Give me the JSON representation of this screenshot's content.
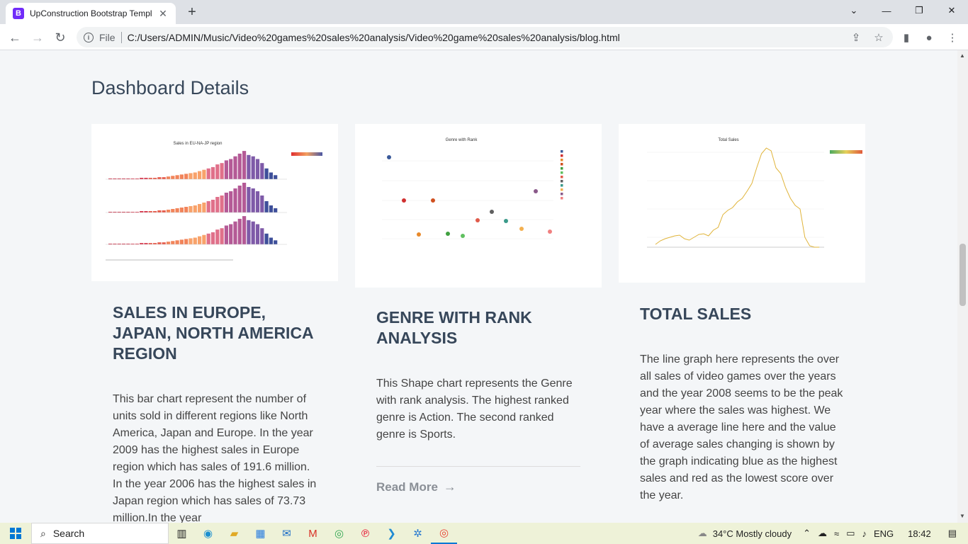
{
  "browser": {
    "tab_title": "UpConstruction Bootstrap Templ",
    "favicon_letter": "B",
    "file_label": "File",
    "url": "C:/Users/ADMIN/Music/Video%20games%20sales%20analysis/Video%20game%20sales%20analysis/blog.html"
  },
  "page": {
    "heading": "Dashboard Details"
  },
  "cards": [
    {
      "title": "SALES IN EUROPE, JAPAN, NORTH AMERICA REGION",
      "text": "This bar chart represent the number of units sold in different regions like North America, Japan and Europe. In the year 2009 has the highest sales in Europe region which has sales of 191.6 million. In the year 2006 has the highest sales in Japan region which has sales of 73.73 million.In the year",
      "chart_title": "Sales in EU-NA-JP region"
    },
    {
      "title": "GENRE WITH RANK ANALYSIS",
      "text": "This Shape chart represents the Genre with rank analysis. The highest ranked genre is Action. The second ranked genre is Sports.",
      "read_more": "Read More",
      "chart_title": "Genre with Rank"
    },
    {
      "title": "TOTAL SALES",
      "text": "The line graph here represents the over all sales of video games over the years and the year 2008 seems to be the peak year where the sales was highest. We have a average line here and the value of average sales changing is shown by the graph indicating blue as the highest sales and red as the lowest score over the year.",
      "chart_title": "Total Sales"
    }
  ],
  "taskbar": {
    "search": "Search",
    "weather": "34°C  Mostly cloudy",
    "lang": "ENG",
    "time": "18:42"
  }
}
